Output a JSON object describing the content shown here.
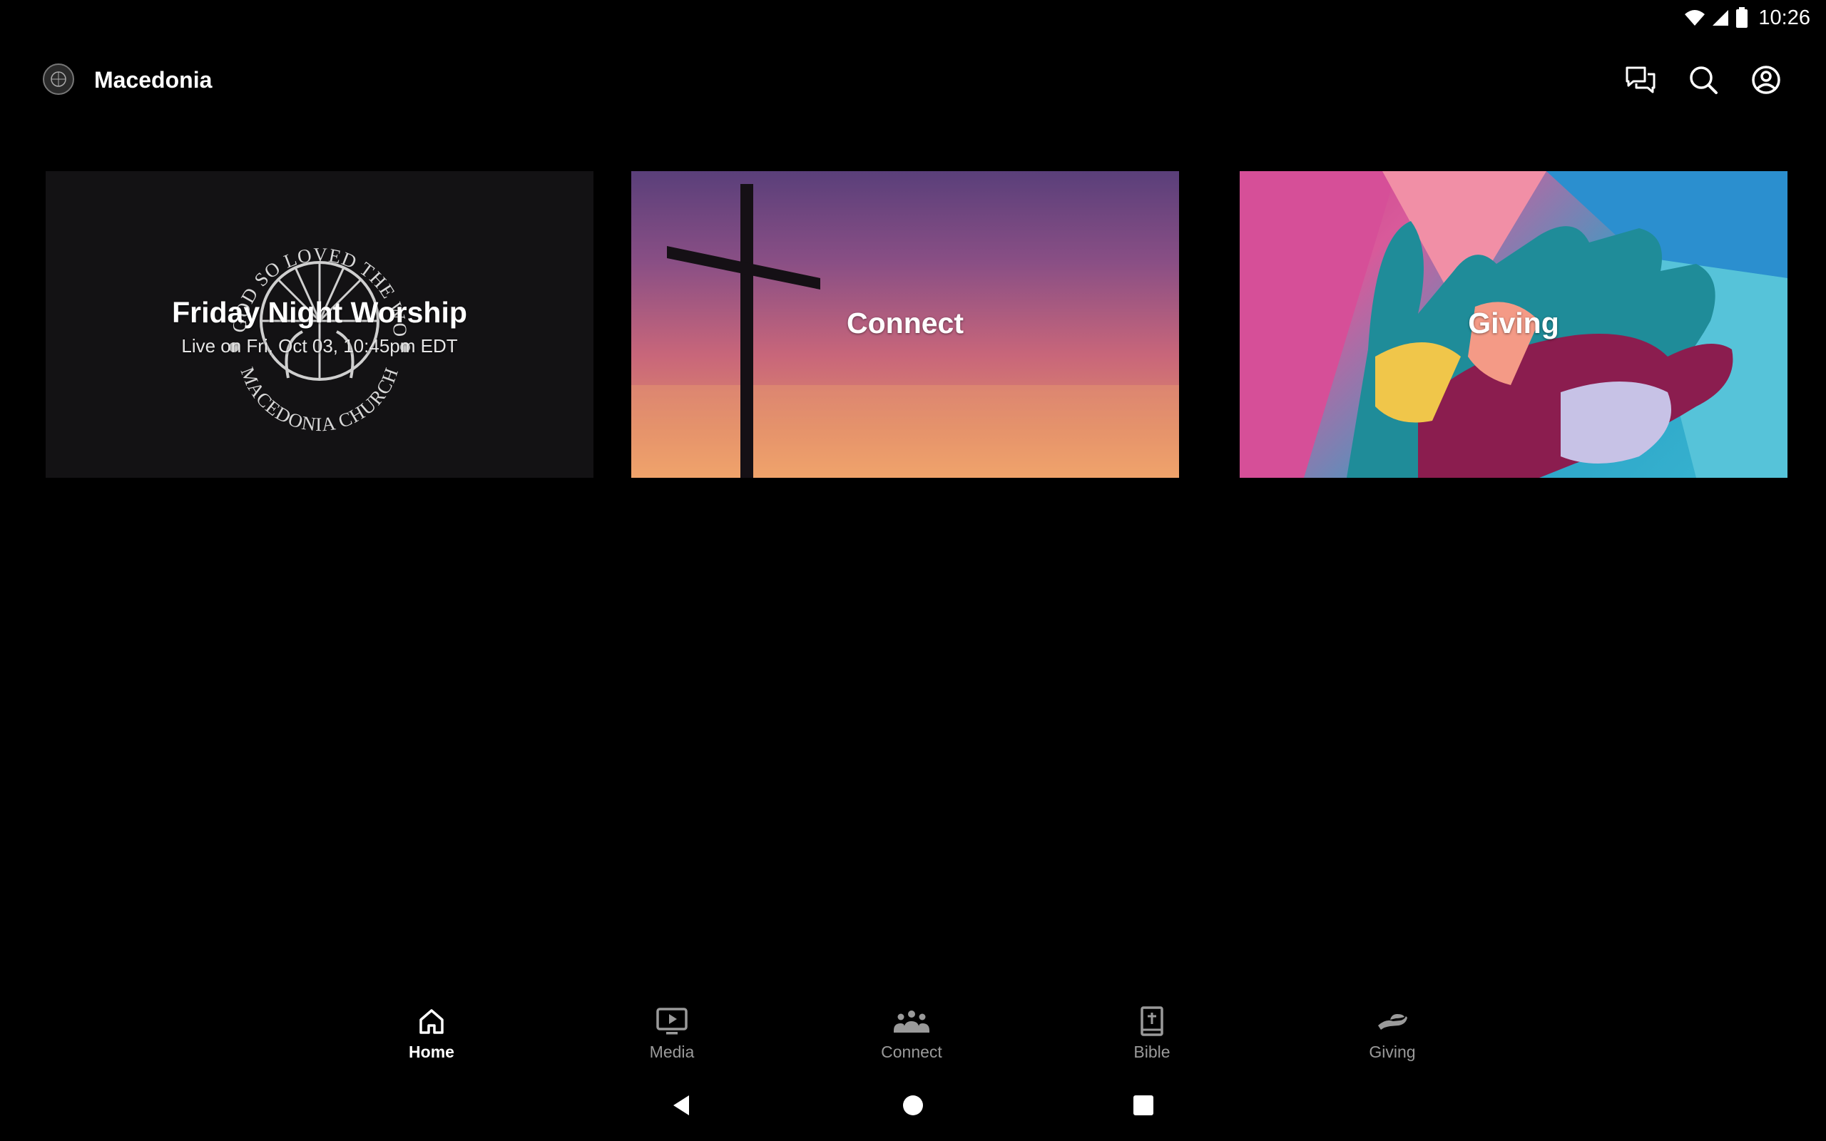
{
  "status": {
    "time": "10:26",
    "icons": [
      "wifi-icon",
      "signal-icon",
      "battery-icon"
    ]
  },
  "app": {
    "title": "Macedonia",
    "actions": [
      "chat-icon",
      "search-icon",
      "account-icon"
    ]
  },
  "cards": [
    {
      "title": "Friday Night Worship",
      "subtitle": "Live on Fri, Oct 03, 10:45pm EDT",
      "logo_text_top": "FOR GOD SO LOVED THE WORLD",
      "logo_text_bottom": "MACEDONIA CHURCH"
    },
    {
      "title": "Connect"
    },
    {
      "title": "Giving"
    }
  ],
  "nav": [
    {
      "label": "Home",
      "icon": "home-icon",
      "active": true
    },
    {
      "label": "Media",
      "icon": "media-icon",
      "active": false
    },
    {
      "label": "Connect",
      "icon": "people-icon",
      "active": false
    },
    {
      "label": "Bible",
      "icon": "bible-icon",
      "active": false
    },
    {
      "label": "Giving",
      "icon": "giving-icon",
      "active": false
    }
  ],
  "colors": {
    "background": "#000000",
    "card_dark": "#131214",
    "nav_inactive": "#9a9a9a"
  }
}
